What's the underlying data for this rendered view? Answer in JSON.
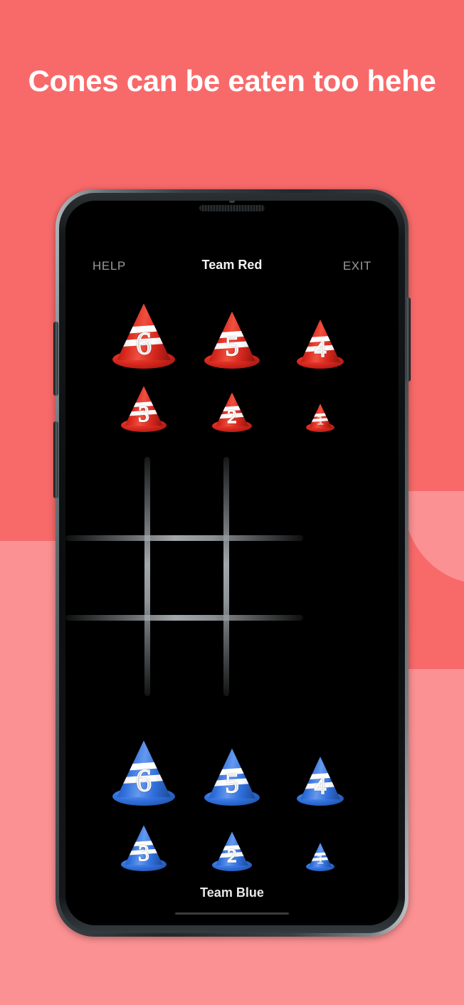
{
  "page": {
    "headline": "Cones can be eaten too hehe",
    "background_top_color": "#f86a6a",
    "background_bottom_color": "#fc9193"
  },
  "app": {
    "topbar": {
      "help_label": "HELP",
      "title": "Team Red",
      "exit_label": "EXIT"
    },
    "bottom_label": "Team Blue",
    "red_team": {
      "name": "Team Red",
      "color": "#d93025",
      "row1": [
        {
          "label": "6",
          "size": 6
        },
        {
          "label": "5",
          "size": 5
        },
        {
          "label": "4",
          "size": 4
        }
      ],
      "row2": [
        {
          "label": "3",
          "size": 3
        },
        {
          "label": "2",
          "size": 2
        },
        {
          "label": "1",
          "size": 1
        }
      ]
    },
    "blue_team": {
      "name": "Team Blue",
      "color": "#2f6fdc",
      "row1": [
        {
          "label": "6",
          "size": 6
        },
        {
          "label": "5",
          "size": 5
        },
        {
          "label": "4",
          "size": 4
        }
      ],
      "row2": [
        {
          "label": "3",
          "size": 3
        },
        {
          "label": "2",
          "size": 2
        },
        {
          "label": "1",
          "size": 1
        }
      ]
    },
    "board": {
      "rows": 3,
      "cols": 3,
      "cells": [
        [
          "",
          "",
          ""
        ],
        [
          "",
          "",
          ""
        ],
        [
          "",
          "",
          ""
        ]
      ],
      "line_color": "#aab0b4"
    }
  }
}
